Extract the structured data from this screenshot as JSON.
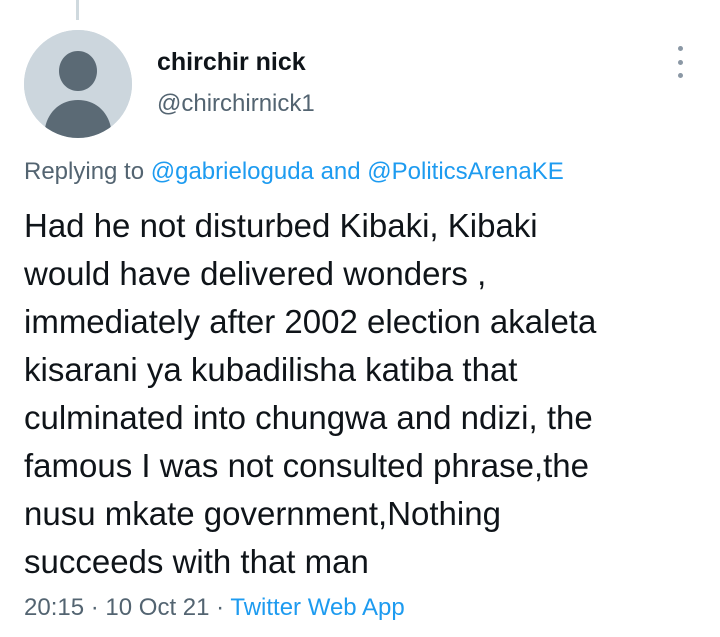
{
  "tweet": {
    "author": {
      "display_name": "chirchir nick",
      "handle": "@chirchirnick1"
    },
    "replying": {
      "prefix": "Replying to",
      "to1": "@gabrieloguda",
      "and": "and",
      "to2": "@PoliticsArenaKE"
    },
    "text_lines": [
      "Had he not disturbed Kibaki, Kibaki",
      "would have delivered wonders ,",
      "immediately after 2002 election akaleta",
      "kisarani ya kubadilisha katiba that",
      "culminated into chungwa and ndizi, the",
      "famous I was not consulted phrase,the",
      "nusu mkate government,Nothing",
      "succeeds with that man"
    ],
    "time": "20:15",
    "separator": "·",
    "date": "10 Oct 21",
    "source": "Twitter Web App"
  },
  "icons": {
    "avatar": "default-profile-icon",
    "more": "more-vertical-icon"
  },
  "colors": {
    "link": "#1d9bf0",
    "secondary_text": "#536471",
    "primary_text": "#0f1419",
    "avatar_bg": "#ccd6dd"
  }
}
